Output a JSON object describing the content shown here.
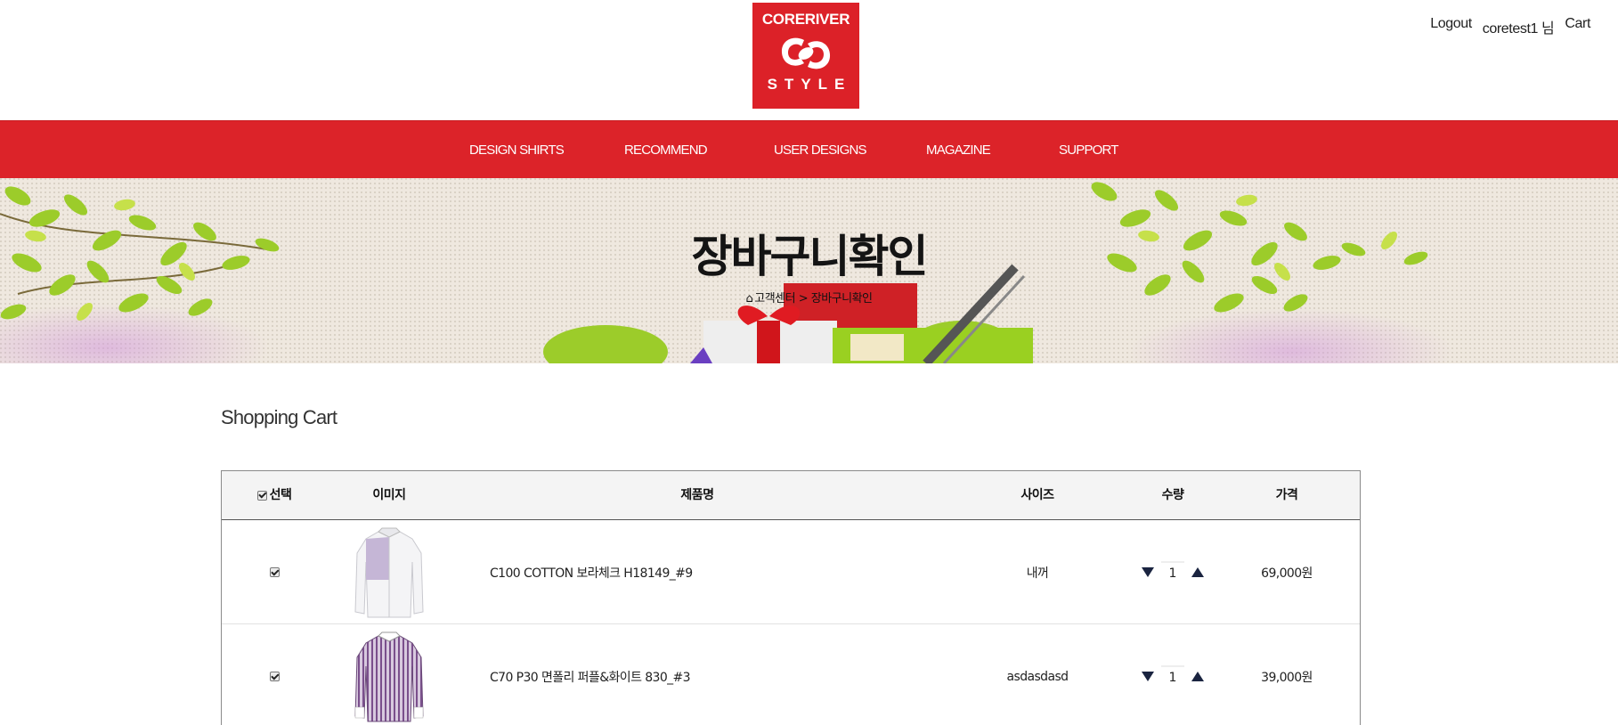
{
  "brand": {
    "logo_top": "CORERIVER",
    "logo_bottom": "STYLE",
    "color": "#dc2128"
  },
  "util_links": {
    "logout": "Logout",
    "user": "coretest1 님",
    "cart": "Cart"
  },
  "nav": {
    "items": [
      "DESIGN SHIRTS",
      "RECOMMEND",
      "USER DESIGNS",
      "MAGAZINE",
      "SUPPORT"
    ]
  },
  "banner": {
    "title": "장바구니확인",
    "breadcrumb": "고객센터 > 장바구니확인",
    "home_icon": "home-icon"
  },
  "section_title": "Shopping Cart",
  "table": {
    "headers": {
      "select": "선택",
      "image": "이미지",
      "product": "제품명",
      "size": "사이즈",
      "quantity": "수량",
      "price": "가격"
    },
    "rows": [
      {
        "checked": true,
        "image": "white-lavender-shirt",
        "product": "C100 COTTON 보라체크 H18149_#9",
        "size": "내꺼",
        "quantity": "1",
        "price": "69,000원"
      },
      {
        "checked": true,
        "image": "purple-stripe-shirt",
        "product": "C70 P30 면폴리 퍼플&화이트 830_#3",
        "size": "asdasdasd",
        "quantity": "1",
        "price": "39,000원"
      }
    ]
  }
}
